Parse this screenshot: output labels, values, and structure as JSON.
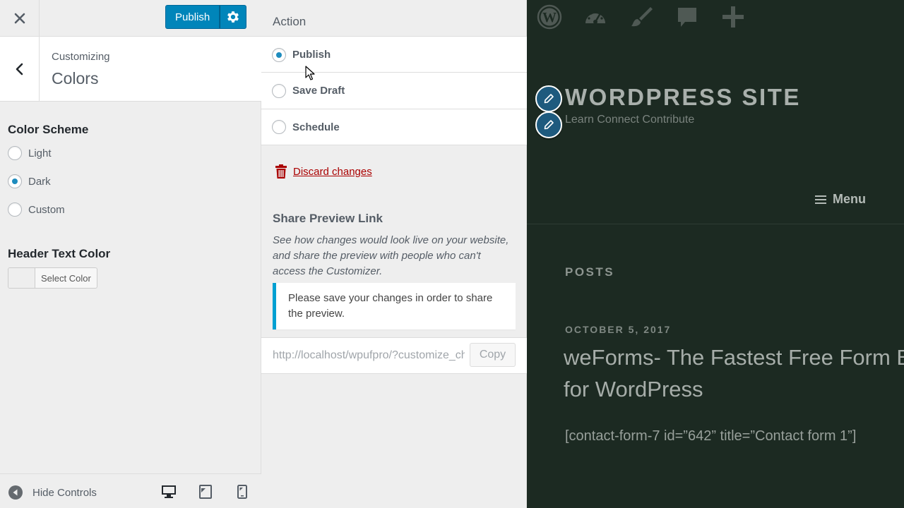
{
  "customizer": {
    "close_label": "Close",
    "publish_label": "Publish",
    "section": {
      "customizing_label": "Customizing",
      "title": "Colors"
    },
    "color_scheme": {
      "title": "Color Scheme",
      "options": [
        "Light",
        "Dark",
        "Custom"
      ],
      "selected": "Dark"
    },
    "header_text_color": {
      "title": "Header Text Color",
      "button_label": "Select Color"
    },
    "footer": {
      "hide_controls_label": "Hide Controls"
    }
  },
  "publish_settings": {
    "action_title": "Action",
    "actions": [
      "Publish",
      "Save Draft",
      "Schedule"
    ],
    "selected_action": "Publish",
    "discard_label": "Discard changes",
    "share": {
      "title": "Share Preview Link",
      "description": "See how changes would look live on your website, and share the preview with people who can't access the Customizer.",
      "notice": "Please save your changes in order to share the preview.",
      "url": "http://localhost/wpufpro/?customize_changeset_uuid",
      "copy_label": "Copy"
    }
  },
  "preview": {
    "site_title": "WORDPRESS SITE",
    "site_description": "Learn Connect Contribute",
    "menu_label": "Menu",
    "posts_label": "POSTS",
    "post": {
      "date": "OCTOBER 5, 2017",
      "title": "weForms- The Fastest Free Form Builder for WordPress",
      "excerpt": "[contact-form-7 id=”642” title=”Contact form 1”]"
    }
  },
  "colors": {
    "accent": "#0085ba",
    "radio_dot": "#1e8cbe",
    "danger": "#aa0000",
    "preview_bg": "#1c2a22"
  }
}
